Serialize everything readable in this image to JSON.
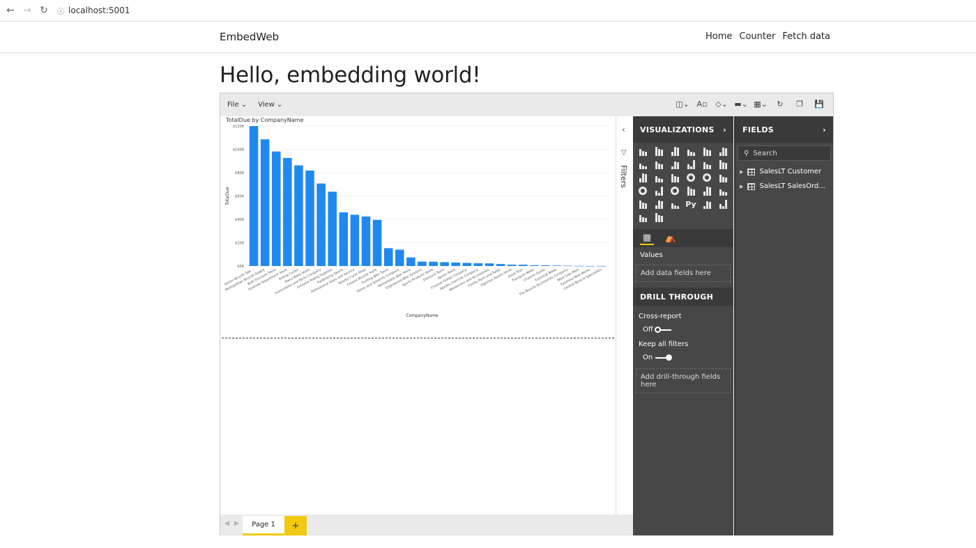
{
  "browser": {
    "url": "localhost:5001"
  },
  "site": {
    "brand": "EmbedWeb",
    "nav": [
      "Home",
      "Counter",
      "Fetch data"
    ],
    "heading": "Hello, embedding world!"
  },
  "pbi": {
    "menus": [
      "File",
      "View"
    ],
    "filters_label": "Filters",
    "viz_title": "VISUALIZATIONS",
    "fields_title": "FIELDS",
    "values_label": "Values",
    "add_values": "Add data fields here",
    "drill_title": "DRILL THROUGH",
    "cross_report": "Cross-report",
    "cross_state": "Off",
    "keep_filters": "Keep all filters",
    "keep_state": "On",
    "add_drill": "Add drill-through fields here",
    "search_placeholder": "Search",
    "tables": [
      "SalesLT Customer",
      "SalesLT SalesOrd..."
    ],
    "page_tab": "Page 1",
    "accent": "#f2c811"
  },
  "chart_data": {
    "type": "bar",
    "title": "TotalDue by CompanyName",
    "xlabel": "CompanyName",
    "ylabel": "TotalDue",
    "ylim": [
      0,
      120000
    ],
    "yticks": [
      "$0K",
      "$20K",
      "$40K",
      "$60K",
      "$80K",
      "$100K",
      "$120K"
    ],
    "color": "#2188f0",
    "categories": [
      "Action Bicycle Spe...",
      "Metropolitan Bicycle Supply",
      "Bulk Discount Store",
      "Eastside Department Store",
      "Riding Cycles",
      "Many Bikes Store",
      "Instruments and Parts Company",
      "Extreme Riding Supplies",
      "Trailblazing Sports",
      "Professional Sales and Service",
      "Nearby Cycle Shop",
      "Closest Bicycle Store",
      "Thrilling Bike Tours",
      "Paints and Solvents Company",
      "Remarkable Bike Store",
      "Engineered Bike Systems",
      "Sports Products Store",
      "Discount Tours",
      "Sports Store",
      "Channel Outlet Company",
      "Aerobic Exercise Company",
      "Westerners and Accessories",
      "Thrifty Parts and Sales",
      "Vigorous Sports Store",
      "Good Toys",
      "Transport Bikes",
      "Channel Outlet",
      "Essential Bikes",
      "The Bicycle Accessories Company",
      "West Side Mart",
      "Essential Bike Works",
      "Central Bicycle Specialists"
    ],
    "values": [
      119960,
      108598,
      98138,
      92663,
      86223,
      81834,
      70698,
      63686,
      45992,
      43962,
      42452,
      39531,
      15275,
      14017,
      7330,
      3754,
      3674,
      3293,
      2981,
      2670,
      2361,
      2228,
      1732,
      1170,
      1141,
      665,
      608,
      407,
      273,
      87,
      46,
      45
    ]
  }
}
